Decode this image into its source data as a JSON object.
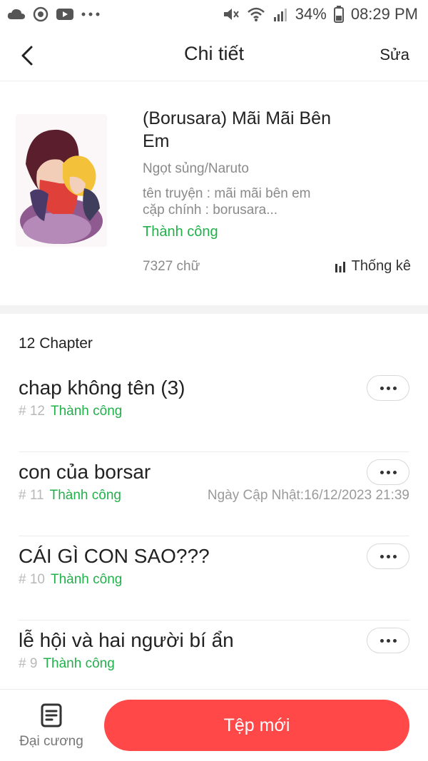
{
  "status_bar": {
    "left_icons": [
      "cloud-icon",
      "sync-icon",
      "youtube-icon",
      "more-dots-icon"
    ],
    "right_icons": [
      "mute-icon",
      "wifi-icon",
      "signal-icon",
      "battery-icon"
    ],
    "battery": "34%",
    "time": "08:29 PM"
  },
  "header": {
    "title": "Chi tiết",
    "edit_label": "Sửa"
  },
  "book": {
    "title": "(Borusara) Mãi Mãi Bên Em",
    "genre": "Ngọt sủng/Naruto",
    "description_line1": "tên truyện : mãi mãi bên em",
    "description_line2": "cặp chính : borusara...",
    "status": "Thành công",
    "word_count": "7327 chữ",
    "stats_label": "Thống kê"
  },
  "chapters_header": "12 Chapter",
  "chapters": [
    {
      "title": "chap không tên (3)",
      "number": "12",
      "status": "Thành công",
      "updated": ""
    },
    {
      "title": "con của borsar",
      "number": "11",
      "status": "Thành công",
      "updated": "Ngày Cập Nhật:16/12/2023 21:39"
    },
    {
      "title": "CÁI GÌ CON SAO???",
      "number": "10",
      "status": "Thành công",
      "updated": ""
    },
    {
      "title": "lễ hội và hai người bí ẩn",
      "number": "9",
      "status": "Thành công",
      "updated": ""
    }
  ],
  "bottom_bar": {
    "outline_label": "Đại cương",
    "new_label": "Tệp mới"
  },
  "colors": {
    "accent": "#ff4847",
    "success": "#22b04b",
    "muted": "#8a8a8a"
  }
}
